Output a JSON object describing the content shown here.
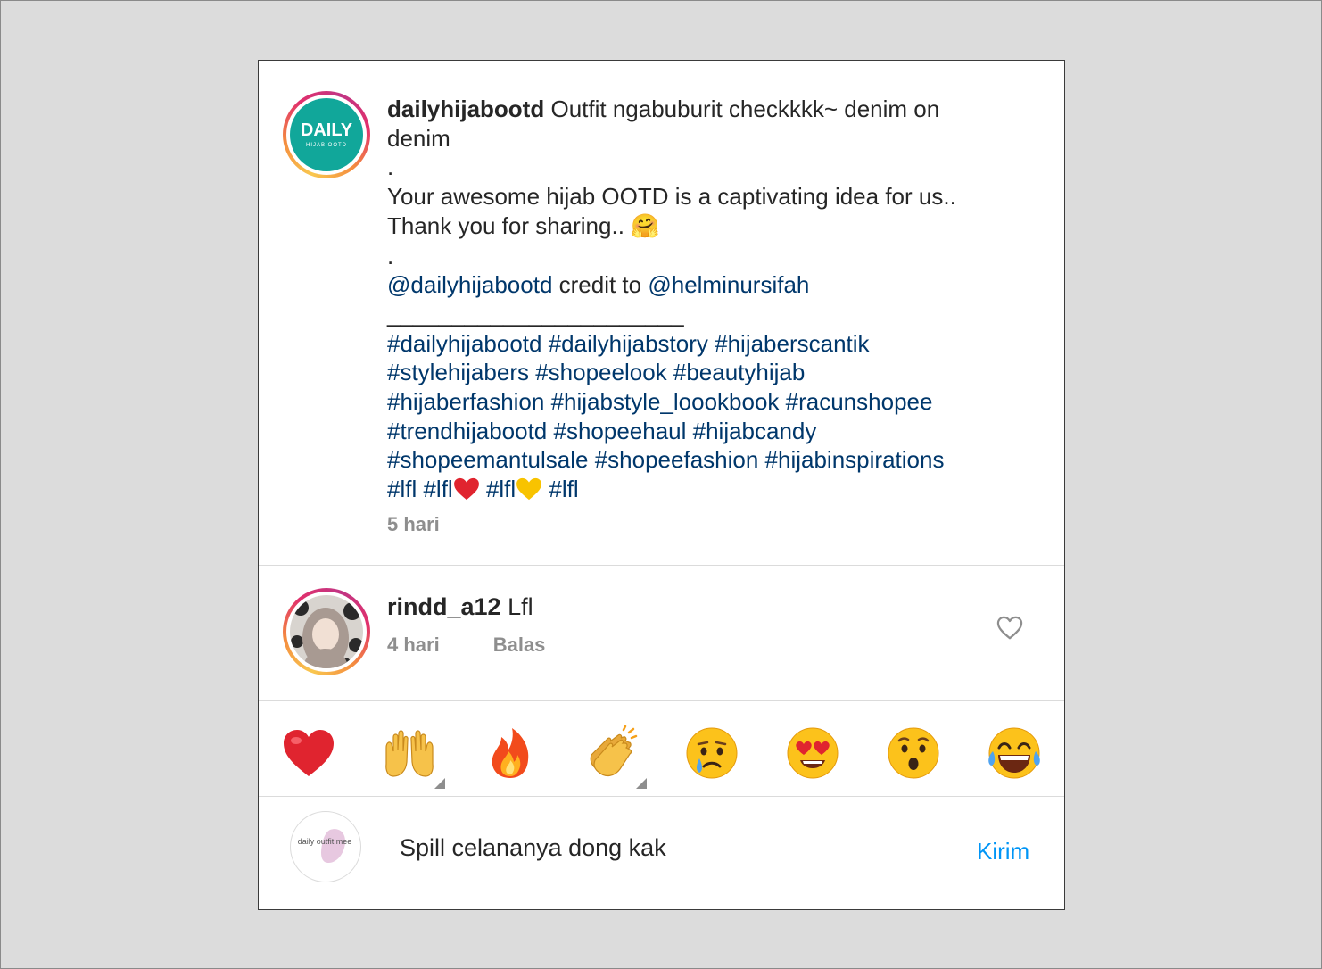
{
  "post": {
    "username": "dailyhijabootd",
    "avatar_text": "DAILY",
    "avatar_subtext": "HIJAB OOTD",
    "caption_line1": "Outfit ngabuburit checkkkk~ denim on",
    "caption_line2": "denim",
    "dot1": ".",
    "caption_line3": "Your awesome hijab OOTD is a captivating idea for us..",
    "caption_line4": "Thank you for sharing.. ",
    "hug_emoji": "🤗",
    "dot2": ".",
    "mention1": "@dailyhijabootd",
    "credit_text": " credit to ",
    "mention2": "@helminursifah",
    "divider": "_______________________",
    "hashtags_line1": "#dailyhijabootd #dailyhijabstory #hijaberscantik",
    "hashtags_line2": "#stylehijabers #shopeelook #beautyhijab",
    "hashtags_line3": "#hijaberfashion #hijabstyle_loookbook #racunshopee",
    "hashtags_line4": "#trendhijabootd #shopeehaul #hijabcandy",
    "hashtags_line5": "#shopeemantulsale #shopeefashion #hijabinspirations",
    "tag_lfl1": "#lfl",
    "tag_lfl2": " #lfl",
    "tag_lfl3": " #lfl",
    "tag_lfl4": " #lfl",
    "time": "5 hari"
  },
  "comment": {
    "username": "rindd_a12",
    "text": " Lfl",
    "time": "4 hari",
    "reply_label": "Balas",
    "like_icon": "heart-outline-icon"
  },
  "emoji_bar": {
    "items": [
      "red-heart",
      "raising-hands",
      "fire",
      "clapping-hands",
      "crying-face",
      "heart-eyes",
      "surprised-face",
      "tears-of-joy"
    ]
  },
  "composer": {
    "avatar_text": "daily outfit.mee",
    "input_value": "Spill celananya dong kak",
    "send_label": "Kirim"
  },
  "colors": {
    "link": "#00376b",
    "send": "#0095f6",
    "muted": "#8e8e8e",
    "text": "#262626"
  }
}
